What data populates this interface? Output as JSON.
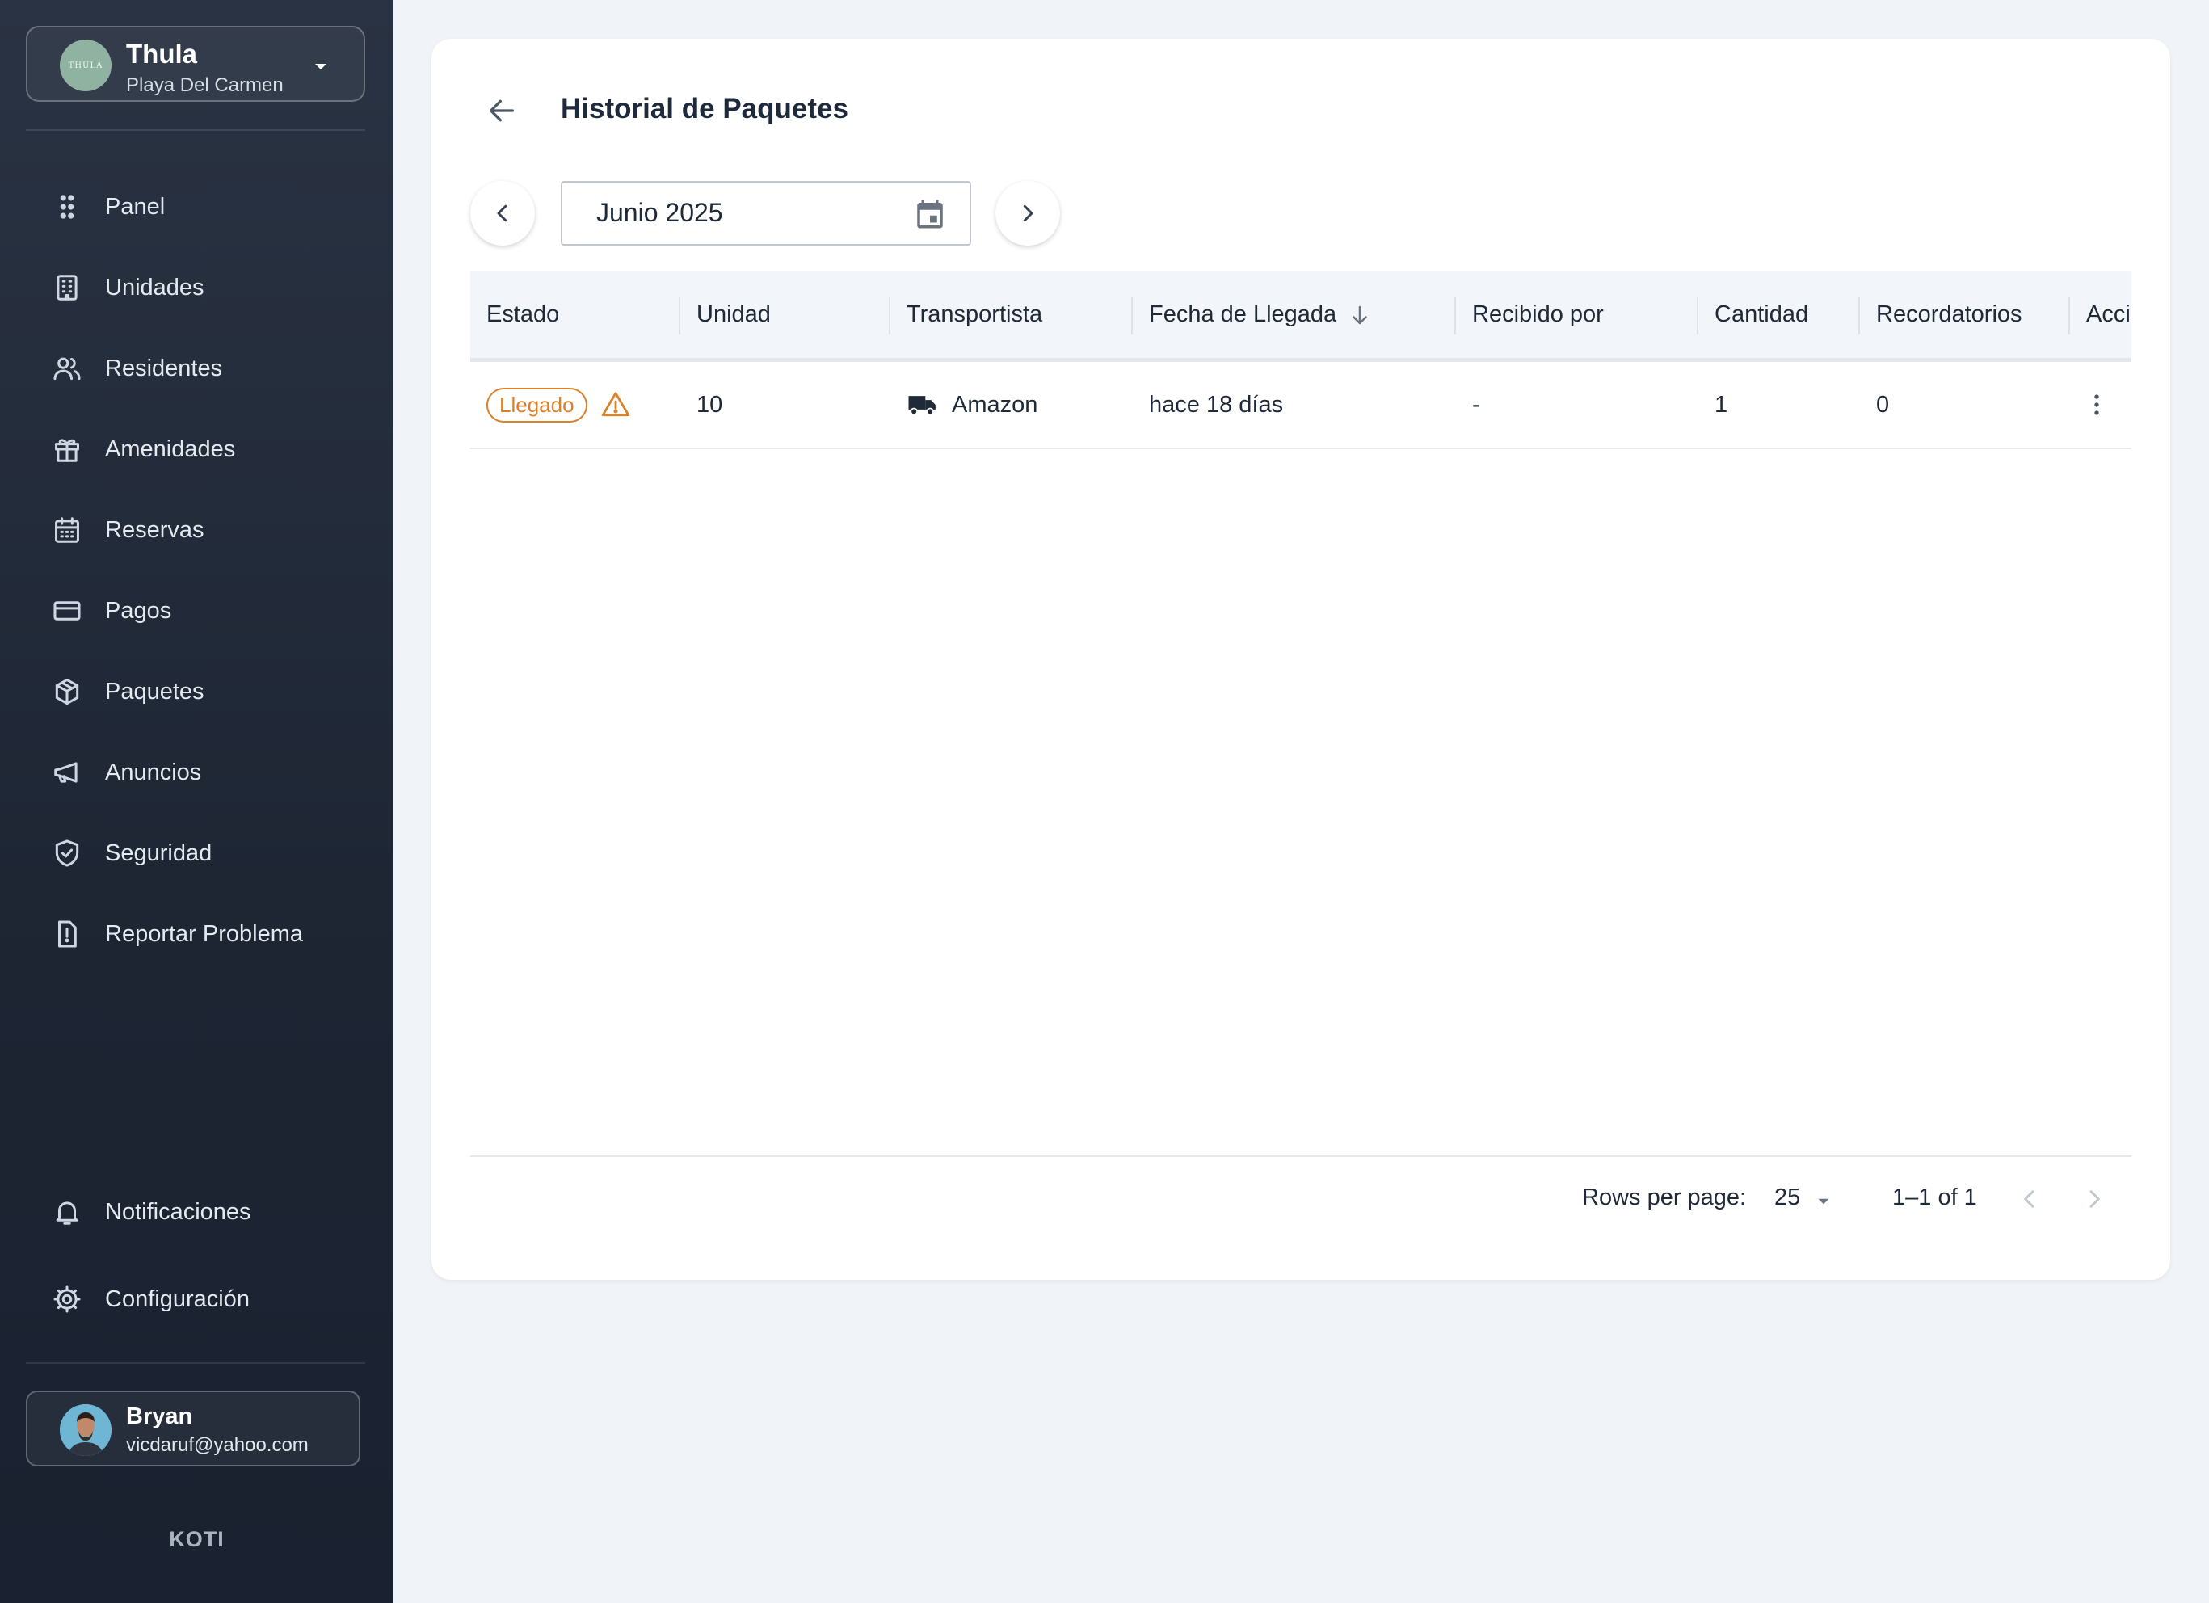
{
  "org": {
    "name": "Thula",
    "location": "Playa Del Carmen",
    "logo_text": "THULA"
  },
  "nav": {
    "items": [
      {
        "label": "Panel",
        "icon": "grid-dots-icon"
      },
      {
        "label": "Unidades",
        "icon": "building-icon"
      },
      {
        "label": "Residentes",
        "icon": "users-icon"
      },
      {
        "label": "Amenidades",
        "icon": "gift-icon"
      },
      {
        "label": "Reservas",
        "icon": "calendar-icon"
      },
      {
        "label": "Pagos",
        "icon": "credit-card-icon"
      },
      {
        "label": "Paquetes",
        "icon": "package-icon"
      },
      {
        "label": "Anuncios",
        "icon": "megaphone-icon"
      },
      {
        "label": "Seguridad",
        "icon": "shield-check-icon"
      },
      {
        "label": "Reportar Problema",
        "icon": "report-icon"
      }
    ],
    "bottom": [
      {
        "label": "Notificaciones",
        "icon": "bell-icon"
      },
      {
        "label": "Configuración",
        "icon": "gear-icon"
      }
    ]
  },
  "user": {
    "name": "Bryan",
    "email": "vicdaruf@yahoo.com"
  },
  "brand": "KOTI",
  "page": {
    "title": "Historial de Paquetes",
    "date_value": "Junio 2025"
  },
  "table": {
    "columns": [
      "Estado",
      "Unidad",
      "Transportista",
      "Fecha de Llegada",
      "Recibido por",
      "Cantidad",
      "Recordatorios",
      "Acciones"
    ],
    "sort_column": "Fecha de Llegada",
    "rows": [
      {
        "estado": "Llegado",
        "unidad": "10",
        "transportista": "Amazon",
        "fecha": "hace 18 días",
        "recibido_por": "-",
        "cantidad": "1",
        "recordatorios": "0"
      }
    ]
  },
  "pagination": {
    "rows_per_page_label": "Rows per page:",
    "rows_per_page": "25",
    "range": "1–1 of 1"
  },
  "colors": {
    "sidebar_top": "#2a3343",
    "sidebar_bottom": "#1a2130",
    "background": "#f0f3f7",
    "warning": "#d9822b"
  }
}
